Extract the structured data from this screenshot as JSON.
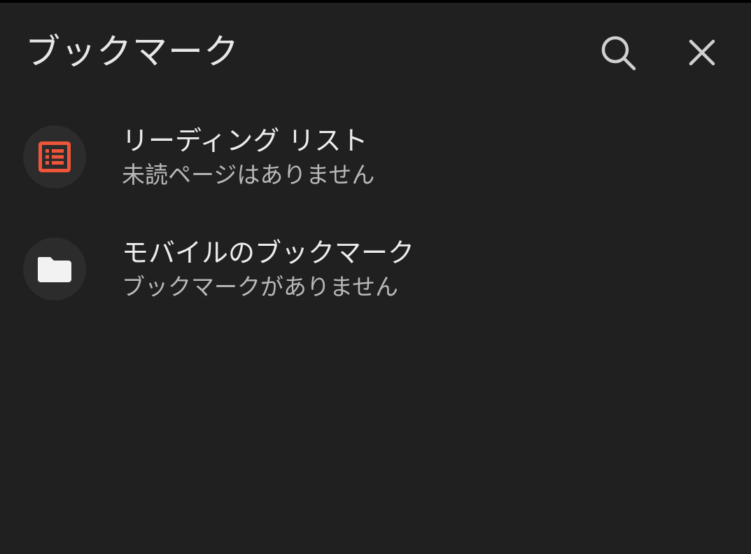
{
  "header": {
    "title": "ブックマーク",
    "search_icon": "search-icon",
    "close_icon": "close-icon"
  },
  "items": [
    {
      "title": "リーディング リスト",
      "subtitle": "未読ページはありません",
      "icon": "reading-list-icon",
      "icon_color": "#f0553a"
    },
    {
      "title": "モバイルのブックマーク",
      "subtitle": "ブックマークがありません",
      "icon": "folder-icon",
      "icon_color": "#f2f2f2"
    }
  ],
  "colors": {
    "background": "#202020",
    "icon_circle": "#2c2c2c",
    "accent": "#f0553a"
  }
}
